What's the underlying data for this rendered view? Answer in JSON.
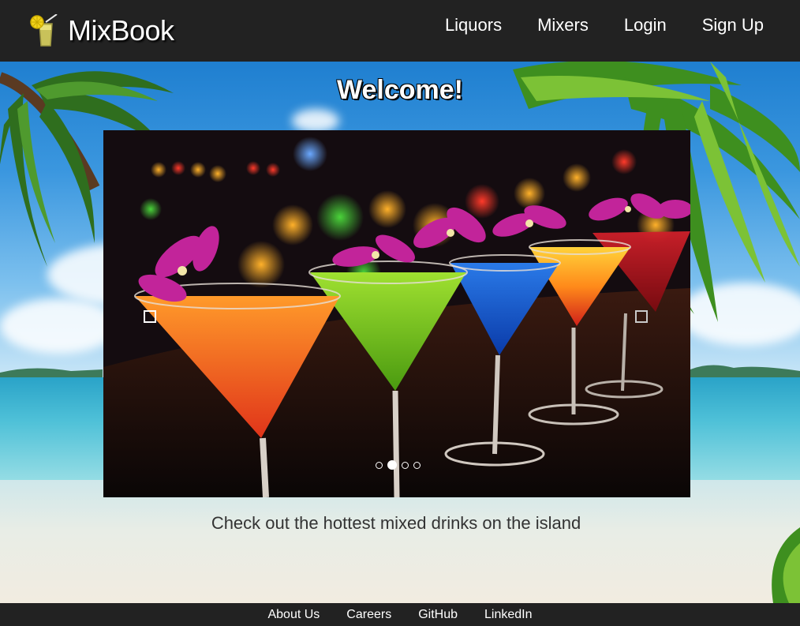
{
  "header": {
    "brand": "MixBook",
    "nav": [
      "Liquors",
      "Mixers",
      "Login",
      "Sign Up"
    ]
  },
  "main": {
    "heading": "Welcome!",
    "carousel": {
      "slide_count": 4,
      "active_index": 1
    },
    "tagline": "Check out the hottest mixed drinks on the island"
  },
  "footer": {
    "links": [
      "About Us",
      "Careers",
      "GitHub",
      "LinkedIn"
    ]
  },
  "colors": {
    "bar": "#222222",
    "text_light": "#ffffff",
    "tagline": "#333333"
  }
}
